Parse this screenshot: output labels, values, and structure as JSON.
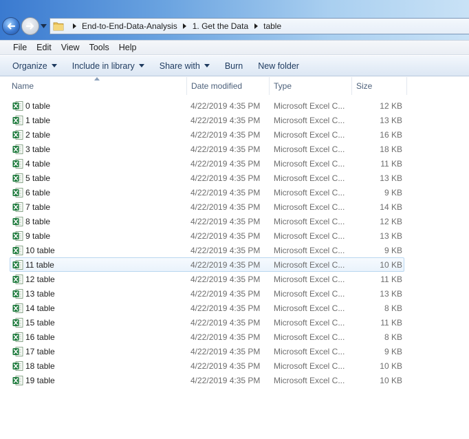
{
  "address": {
    "breadcrumbs": [
      "End-to-End-Data-Analysis",
      "1. Get the Data",
      "table"
    ]
  },
  "menu": [
    "File",
    "Edit",
    "View",
    "Tools",
    "Help"
  ],
  "toolbar": {
    "organize": "Organize",
    "include_in_library": "Include in library",
    "share_with": "Share with",
    "burn": "Burn",
    "new_folder": "New folder"
  },
  "columns": {
    "name": "Name",
    "date_modified": "Date modified",
    "type": "Type",
    "size": "Size"
  },
  "files": [
    {
      "name": "0 table",
      "date": "4/22/2019 4:35 PM",
      "type": "Microsoft Excel C...",
      "size": "12 KB"
    },
    {
      "name": "1 table",
      "date": "4/22/2019 4:35 PM",
      "type": "Microsoft Excel C...",
      "size": "13 KB"
    },
    {
      "name": "2 table",
      "date": "4/22/2019 4:35 PM",
      "type": "Microsoft Excel C...",
      "size": "16 KB"
    },
    {
      "name": "3 table",
      "date": "4/22/2019 4:35 PM",
      "type": "Microsoft Excel C...",
      "size": "18 KB"
    },
    {
      "name": "4 table",
      "date": "4/22/2019 4:35 PM",
      "type": "Microsoft Excel C...",
      "size": "11 KB"
    },
    {
      "name": "5 table",
      "date": "4/22/2019 4:35 PM",
      "type": "Microsoft Excel C...",
      "size": "13 KB"
    },
    {
      "name": "6 table",
      "date": "4/22/2019 4:35 PM",
      "type": "Microsoft Excel C...",
      "size": "9 KB"
    },
    {
      "name": "7 table",
      "date": "4/22/2019 4:35 PM",
      "type": "Microsoft Excel C...",
      "size": "14 KB"
    },
    {
      "name": "8 table",
      "date": "4/22/2019 4:35 PM",
      "type": "Microsoft Excel C...",
      "size": "12 KB"
    },
    {
      "name": "9 table",
      "date": "4/22/2019 4:35 PM",
      "type": "Microsoft Excel C...",
      "size": "13 KB"
    },
    {
      "name": "10 table",
      "date": "4/22/2019 4:35 PM",
      "type": "Microsoft Excel C...",
      "size": "9 KB"
    },
    {
      "name": "11 table",
      "date": "4/22/2019 4:35 PM",
      "type": "Microsoft Excel C...",
      "size": "10 KB",
      "hovered": true
    },
    {
      "name": "12 table",
      "date": "4/22/2019 4:35 PM",
      "type": "Microsoft Excel C...",
      "size": "11 KB"
    },
    {
      "name": "13 table",
      "date": "4/22/2019 4:35 PM",
      "type": "Microsoft Excel C...",
      "size": "13 KB"
    },
    {
      "name": "14 table",
      "date": "4/22/2019 4:35 PM",
      "type": "Microsoft Excel C...",
      "size": "8 KB"
    },
    {
      "name": "15 table",
      "date": "4/22/2019 4:35 PM",
      "type": "Microsoft Excel C...",
      "size": "11 KB"
    },
    {
      "name": "16 table",
      "date": "4/22/2019 4:35 PM",
      "type": "Microsoft Excel C...",
      "size": "8 KB"
    },
    {
      "name": "17 table",
      "date": "4/22/2019 4:35 PM",
      "type": "Microsoft Excel C...",
      "size": "9 KB"
    },
    {
      "name": "18 table",
      "date": "4/22/2019 4:35 PM",
      "type": "Microsoft Excel C...",
      "size": "10 KB"
    },
    {
      "name": "19 table",
      "date": "4/22/2019 4:35 PM",
      "type": "Microsoft Excel C...",
      "size": "10 KB"
    }
  ],
  "icons": {
    "back": "back-arrow-icon",
    "forward": "forward-arrow-icon",
    "history": "chevron-down-icon",
    "location": "folder-icon",
    "file": "excel-csv-icon"
  },
  "colors": {
    "address_gradient_start": "#3a7ad0",
    "toolbar_text": "#1e3a5f",
    "excel_green": "#1d7a3c",
    "hover_border": "#b8d6f0"
  }
}
